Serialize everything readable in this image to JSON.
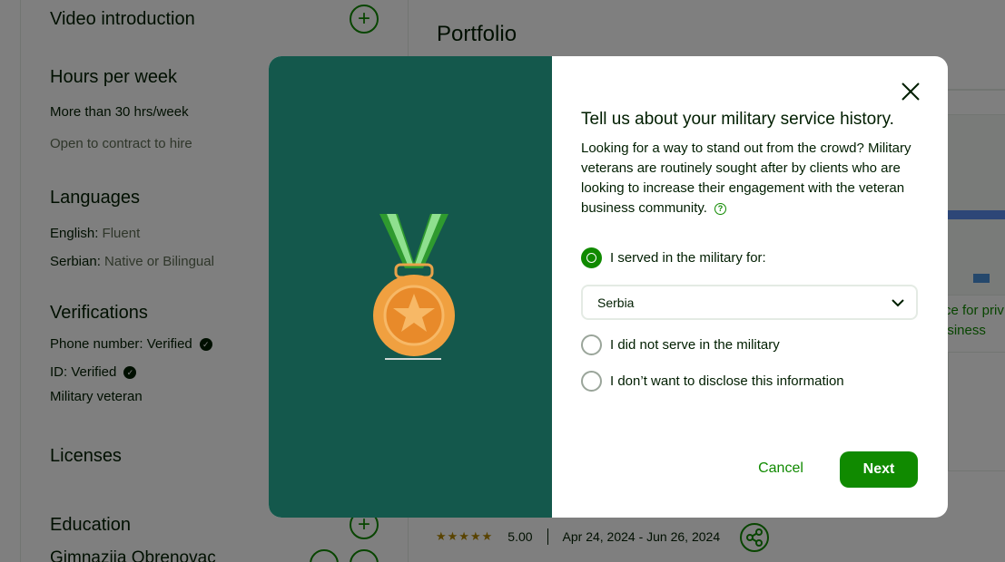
{
  "background": {
    "sidebar": {
      "video_intro_title": "Video introduction",
      "hours_title": "Hours per week",
      "hours_value": "More than 30 hrs/week",
      "contract_text": "Open to contract to hire",
      "languages_title": "Languages",
      "languages": [
        {
          "name": "English:",
          "level": "Fluent"
        },
        {
          "name": "Serbian:",
          "level": "Native or Bilingual"
        }
      ],
      "verifications_title": "Verifications",
      "phone_verified": "Phone number: Verified",
      "id_verified": "ID: Verified",
      "military_veteran": "Military veteran",
      "licenses_title": "Licenses",
      "education_title": "Education",
      "education_item": "Gimnazija Obrenovac"
    },
    "main": {
      "portfolio_title": "Portfolio",
      "link_fragment_1": "ce for priv",
      "link_fragment_2": "isiness",
      "rating": "5.00",
      "stars": "★★★★★",
      "date_range": "Apr 24, 2024 - Jun 26, 2024"
    }
  },
  "modal": {
    "title": "Tell us about your military service history.",
    "description": "Looking for a way to stand out from the crowd? Military veterans are routinely sought after by clients who are looking to increase their engagement with the veteran business community.",
    "options": [
      {
        "label": "I served in the military for:",
        "selected": true
      },
      {
        "label": "I did not serve in the military",
        "selected": false
      },
      {
        "label": "I don’t want to disclose this information",
        "selected": false
      }
    ],
    "country_select": {
      "value": "Serbia"
    },
    "cancel_label": "Cancel",
    "next_label": "Next"
  },
  "colors": {
    "brand_green": "#108a00",
    "modal_left_bg": "#14584c",
    "text": "#001e00"
  },
  "icons": [
    "plus-icon",
    "check-badge-icon",
    "close-icon",
    "help-icon",
    "chevron-down-icon",
    "medal-icon",
    "share-icon"
  ]
}
